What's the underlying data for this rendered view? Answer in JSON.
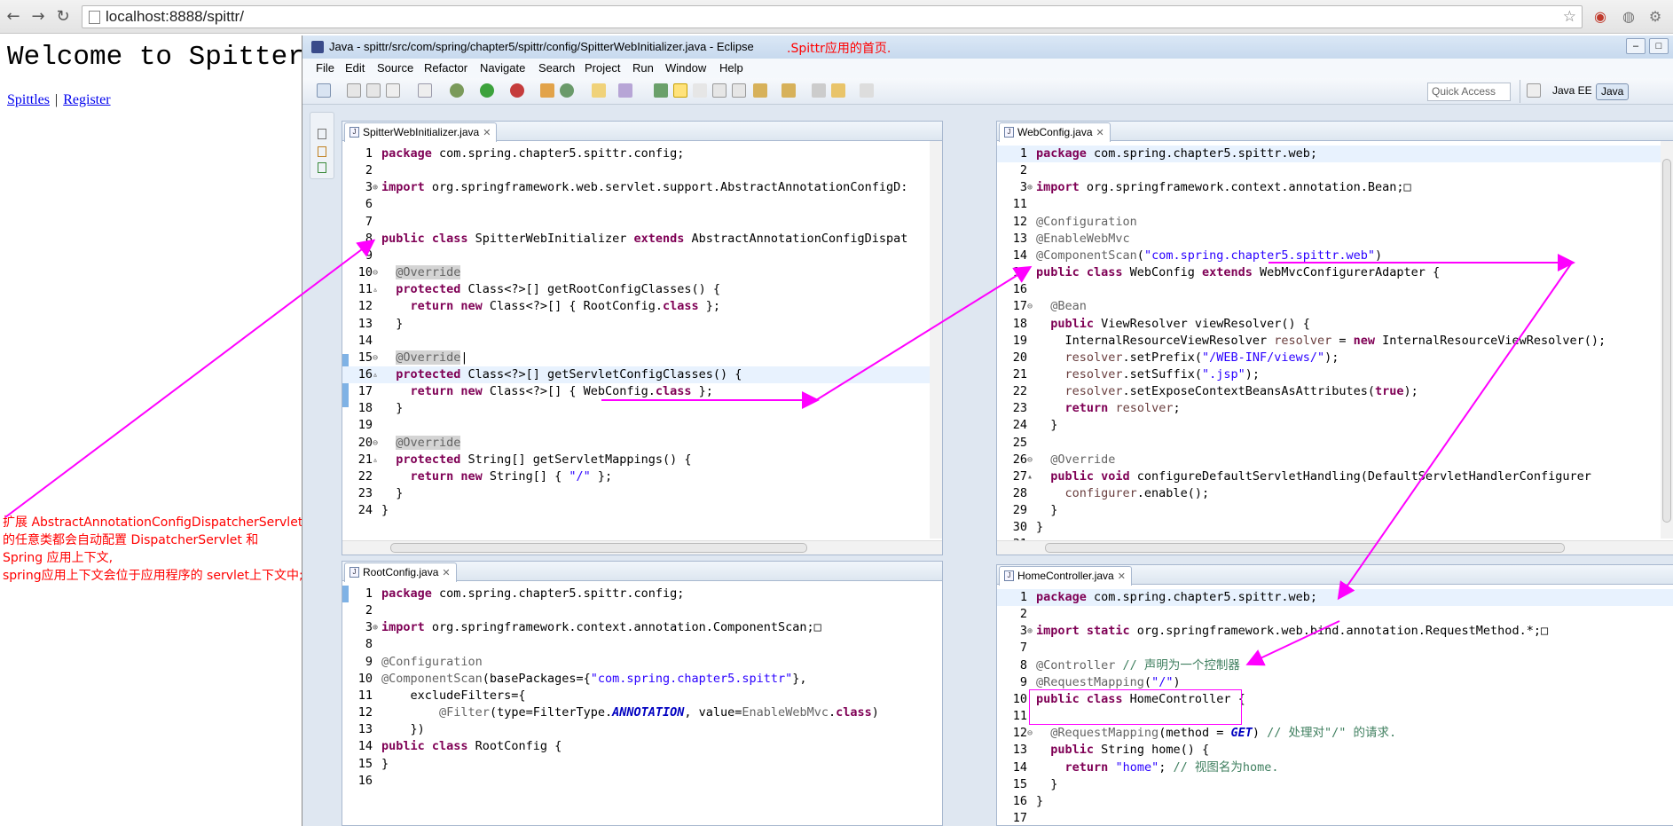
{
  "browser": {
    "url": "localhost:8888/spittr/",
    "back_icon": "back-arrow-icon",
    "forward_icon": "forward-arrow-icon",
    "reload_icon": "reload-icon"
  },
  "page": {
    "heading": "Welcome to Spitter",
    "link_spittles": "Spittles",
    "link_separator": "|",
    "link_register": "Register"
  },
  "annotation": {
    "line1": "扩展 AbstractAnnotationConfigDispatcherServletInitializer",
    "line2": "的任意类都会自动配置 DispatcherServlet 和",
    "line3": "Spring 应用上下文,",
    "line4": "spring应用上下文会位于应用程序的 servlet上下文中;"
  },
  "eclipse": {
    "title": "Java - spittr/src/com/spring/chapter5/spittr/config/SpitterWebInitializer.java - Eclipse",
    "title_note": ".Spittr应用的首页.",
    "menus": [
      "File",
      "Edit",
      "Source",
      "Refactor",
      "Navigate",
      "Search",
      "Project",
      "Run",
      "Window",
      "Help"
    ],
    "quick_access": "Quick Access",
    "perspective_java_ee": "Java EE",
    "perspective_java": "Java"
  },
  "editors": {
    "initializer": {
      "tab": "SpitterWebInitializer.java",
      "lines": [
        {
          "n": "1",
          "html": "<span class='kw'>package</span> com.spring.chapter5.spittr.config;"
        },
        {
          "n": "2",
          "html": ""
        },
        {
          "n": "3",
          "m": "⊕",
          "html": "<span class='kw'>import</span> org.springframework.web.servlet.support.AbstractAnnotationConfigD:"
        },
        {
          "n": "6",
          "html": ""
        },
        {
          "n": "7",
          "html": ""
        },
        {
          "n": "8",
          "html": "<span class='kw'>public class</span> SpitterWebInitializer <span class='kw'>extends</span> AbstractAnnotationConfigDispat"
        },
        {
          "n": "9",
          "html": ""
        },
        {
          "n": "10",
          "m": "⊖",
          "html": "  <span class='an ovr'>@Override</span>"
        },
        {
          "n": "11",
          "m": "▵",
          "html": "  <span class='kw'>protected</span> Class&lt;?&gt;[] getRootConfigClasses() {"
        },
        {
          "n": "12",
          "html": "    <span class='kw'>return new</span> Class&lt;?&gt;[] { RootConfig.<span class='kw'>class</span> };"
        },
        {
          "n": "13",
          "html": "  }"
        },
        {
          "n": "14",
          "html": ""
        },
        {
          "n": "15",
          "m": "⊖",
          "html": "  <span class='an ovr'>@Override</span>|"
        },
        {
          "n": "16",
          "m": "▵",
          "html": "  <span class='kw'>protected</span> Class&lt;?&gt;[] getServletConfigClasses() {"
        },
        {
          "n": "17",
          "html": "    <span class='kw'>return new</span> Class&lt;?&gt;[] { WebConfig.<span class='kw'>class</span> };"
        },
        {
          "n": "18",
          "html": "  }"
        },
        {
          "n": "19",
          "html": ""
        },
        {
          "n": "20",
          "m": "⊖",
          "html": "  <span class='an ovr'>@Override</span>"
        },
        {
          "n": "21",
          "m": "▵",
          "html": "  <span class='kw'>protected</span> String[] getServletMappings() {"
        },
        {
          "n": "22",
          "html": "    <span class='kw'>return new</span> String[] { <span class='str'>\"/\"</span> };"
        },
        {
          "n": "23",
          "html": "  }"
        },
        {
          "n": "24",
          "html": "}"
        }
      ]
    },
    "webconfig": {
      "tab": "WebConfig.java",
      "lines": [
        {
          "n": "1",
          "html": "<span class='kw'>package</span> com.spring.chapter5.spittr.web;"
        },
        {
          "n": "2",
          "html": ""
        },
        {
          "n": "3",
          "m": "⊕",
          "html": "<span class='kw'>import</span> org.springframework.context.annotation.Bean;□"
        },
        {
          "n": "11",
          "html": ""
        },
        {
          "n": "12",
          "html": "<span class='an'>@Configuration</span>"
        },
        {
          "n": "13",
          "html": "<span class='an'>@EnableWebMvc</span>"
        },
        {
          "n": "14",
          "html": "<span class='an'>@ComponentScan</span>(<span class='str'>\"com.spring.chapter5.spittr.web\"</span>)"
        },
        {
          "n": "15",
          "html": "<span class='kw'>public class</span> WebConfig <span class='kw'>extends</span> WebMvcConfigurerAdapter {"
        },
        {
          "n": "16",
          "html": ""
        },
        {
          "n": "17",
          "m": "⊖",
          "html": "  <span class='an'>@Bean</span>"
        },
        {
          "n": "18",
          "html": "  <span class='kw'>public</span> ViewResolver viewResolver() {"
        },
        {
          "n": "19",
          "html": "    InternalResourceViewResolver <span class='var'>resolver</span> = <span class='kw'>new</span> InternalResourceViewResolver();"
        },
        {
          "n": "20",
          "html": "    <span class='var'>resolver</span>.setPrefix(<span class='str'>\"/WEB-INF/views/\"</span>);"
        },
        {
          "n": "21",
          "html": "    <span class='var'>resolver</span>.setSuffix(<span class='str'>\".jsp\"</span>);"
        },
        {
          "n": "22",
          "html": "    <span class='var'>resolver</span>.setExposeContextBeansAsAttributes(<span class='kw'>true</span>);"
        },
        {
          "n": "23",
          "html": "    <span class='kw'>return</span> <span class='var'>resolver</span>;"
        },
        {
          "n": "24",
          "html": "  }"
        },
        {
          "n": "25",
          "html": ""
        },
        {
          "n": "26",
          "m": "⊖",
          "html": "  <span class='an'>@Override</span>"
        },
        {
          "n": "27",
          "m": "▴",
          "html": "  <span class='kw'>public void</span> configureDefaultServletHandling(DefaultServletHandlerConfigurer"
        },
        {
          "n": "28",
          "html": "    <span class='var'>configurer</span>.enable();"
        },
        {
          "n": "29",
          "html": "  }"
        },
        {
          "n": "30",
          "html": "}"
        },
        {
          "n": "31",
          "html": ""
        }
      ]
    },
    "rootconfig": {
      "tab": "RootConfig.java",
      "lines": [
        {
          "n": "1",
          "html": "<span class='kw'>package</span> com.spring.chapter5.spittr.config;"
        },
        {
          "n": "2",
          "html": ""
        },
        {
          "n": "3",
          "m": "⊕",
          "html": "<span class='kw'>import</span> org.springframework.context.annotation.ComponentScan;□"
        },
        {
          "n": "8",
          "html": ""
        },
        {
          "n": "9",
          "html": "<span class='an'>@Configuration</span>"
        },
        {
          "n": "10",
          "html": "<span class='an'>@ComponentScan</span>(basePackages={<span class='str'>\"com.spring.chapter5.spittr\"</span>},"
        },
        {
          "n": "11",
          "html": "    excludeFilters={"
        },
        {
          "n": "12",
          "html": "        <span class='an'>@Filter</span>(type=FilterType.<span class='fld'><b>ANNOTATION</b></span>, value=<span class='an'>EnableWebMvc</span>.<span class='kw'>class</span>)"
        },
        {
          "n": "13",
          "html": "    })"
        },
        {
          "n": "14",
          "html": "<span class='kw'>public class</span> RootConfig {"
        },
        {
          "n": "15",
          "html": "}"
        },
        {
          "n": "16",
          "html": ""
        }
      ]
    },
    "homecontroller": {
      "tab": "HomeController.java",
      "lines": [
        {
          "n": "1",
          "html": "<span class='kw'>package</span> com.spring.chapter5.spittr.web;"
        },
        {
          "n": "2",
          "html": ""
        },
        {
          "n": "3",
          "m": "⊕",
          "html": "<span class='kw'>import static</span> org.springframework.web.bind.annotation.RequestMethod.*;□"
        },
        {
          "n": "7",
          "html": ""
        },
        {
          "n": "8",
          "html": "<span class='an'>@Controller</span> <span class='cm'>// 声明为一个控制器</span>"
        },
        {
          "n": "9",
          "html": "<span class='an'>@RequestMapping</span>(<span class='str'>\"/\"</span>)"
        },
        {
          "n": "10",
          "html": "<span class='kw'>public class</span> HomeController {"
        },
        {
          "n": "11",
          "html": ""
        },
        {
          "n": "12",
          "m": "⊖",
          "html": "  <span class='an'>@RequestMapping</span>(method = <span class='fld'><b>GET</b></span>) <span class='cm'>// 处理对\"/\" 的请求.</span>"
        },
        {
          "n": "13",
          "html": "  <span class='kw'>public</span> String home() {"
        },
        {
          "n": "14",
          "html": "    <span class='kw'>return</span> <span class='str'>\"home\"</span>; <span class='cm'>// 视图名为home.</span>"
        },
        {
          "n": "15",
          "html": "  }"
        },
        {
          "n": "16",
          "html": "}"
        },
        {
          "n": "17",
          "html": ""
        }
      ]
    }
  }
}
